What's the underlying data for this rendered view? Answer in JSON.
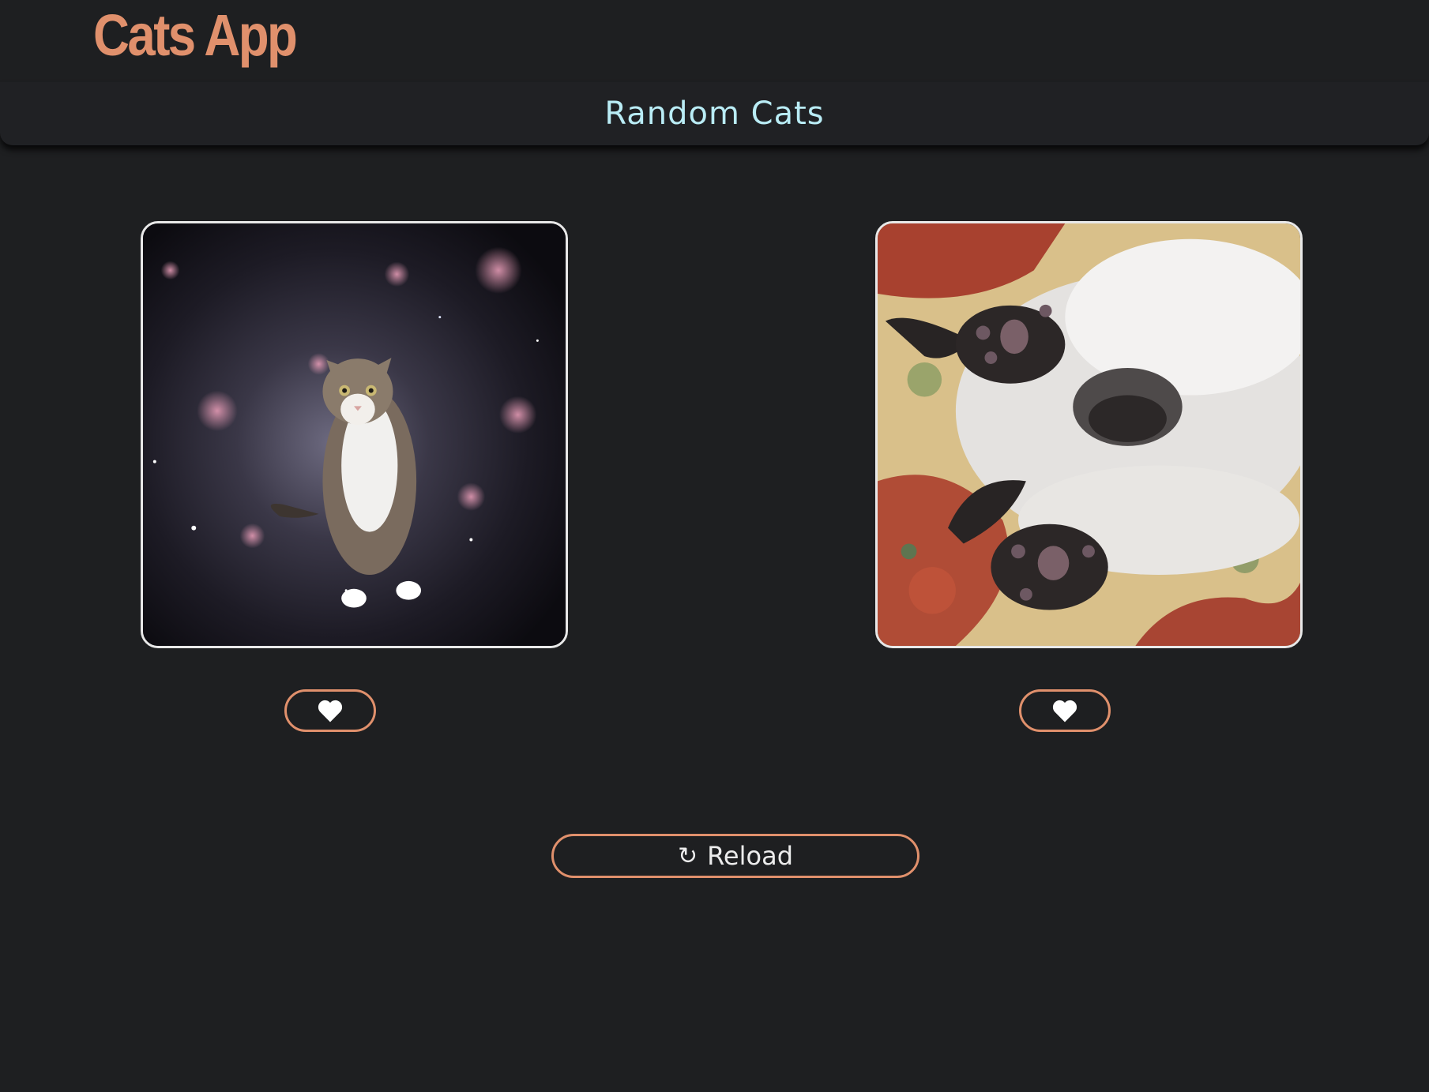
{
  "app": {
    "title": "Cats App"
  },
  "header": {
    "title": "Random Cats"
  },
  "cards": [
    {
      "like_icon": "heart-icon"
    },
    {
      "like_icon": "heart-icon"
    }
  ],
  "reload": {
    "icon": "↻",
    "label": "Reload"
  },
  "colors": {
    "background": "#1e1f21",
    "brand": "#e0906c",
    "accent_border": "#e0906c",
    "header_text": "#b9ecf5",
    "heart": "#ffffff"
  }
}
